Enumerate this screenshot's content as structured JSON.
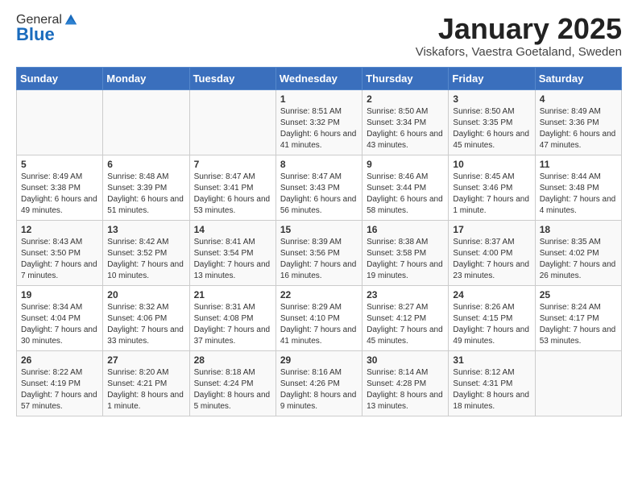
{
  "header": {
    "logo_general": "General",
    "logo_blue": "Blue",
    "month_year": "January 2025",
    "location": "Viskafors, Vaestra Goetaland, Sweden"
  },
  "weekdays": [
    "Sunday",
    "Monday",
    "Tuesday",
    "Wednesday",
    "Thursday",
    "Friday",
    "Saturday"
  ],
  "weeks": [
    [
      {
        "day": "",
        "info": ""
      },
      {
        "day": "",
        "info": ""
      },
      {
        "day": "",
        "info": ""
      },
      {
        "day": "1",
        "info": "Sunrise: 8:51 AM\nSunset: 3:32 PM\nDaylight: 6 hours and 41 minutes."
      },
      {
        "day": "2",
        "info": "Sunrise: 8:50 AM\nSunset: 3:34 PM\nDaylight: 6 hours and 43 minutes."
      },
      {
        "day": "3",
        "info": "Sunrise: 8:50 AM\nSunset: 3:35 PM\nDaylight: 6 hours and 45 minutes."
      },
      {
        "day": "4",
        "info": "Sunrise: 8:49 AM\nSunset: 3:36 PM\nDaylight: 6 hours and 47 minutes."
      }
    ],
    [
      {
        "day": "5",
        "info": "Sunrise: 8:49 AM\nSunset: 3:38 PM\nDaylight: 6 hours and 49 minutes."
      },
      {
        "day": "6",
        "info": "Sunrise: 8:48 AM\nSunset: 3:39 PM\nDaylight: 6 hours and 51 minutes."
      },
      {
        "day": "7",
        "info": "Sunrise: 8:47 AM\nSunset: 3:41 PM\nDaylight: 6 hours and 53 minutes."
      },
      {
        "day": "8",
        "info": "Sunrise: 8:47 AM\nSunset: 3:43 PM\nDaylight: 6 hours and 56 minutes."
      },
      {
        "day": "9",
        "info": "Sunrise: 8:46 AM\nSunset: 3:44 PM\nDaylight: 6 hours and 58 minutes."
      },
      {
        "day": "10",
        "info": "Sunrise: 8:45 AM\nSunset: 3:46 PM\nDaylight: 7 hours and 1 minute."
      },
      {
        "day": "11",
        "info": "Sunrise: 8:44 AM\nSunset: 3:48 PM\nDaylight: 7 hours and 4 minutes."
      }
    ],
    [
      {
        "day": "12",
        "info": "Sunrise: 8:43 AM\nSunset: 3:50 PM\nDaylight: 7 hours and 7 minutes."
      },
      {
        "day": "13",
        "info": "Sunrise: 8:42 AM\nSunset: 3:52 PM\nDaylight: 7 hours and 10 minutes."
      },
      {
        "day": "14",
        "info": "Sunrise: 8:41 AM\nSunset: 3:54 PM\nDaylight: 7 hours and 13 minutes."
      },
      {
        "day": "15",
        "info": "Sunrise: 8:39 AM\nSunset: 3:56 PM\nDaylight: 7 hours and 16 minutes."
      },
      {
        "day": "16",
        "info": "Sunrise: 8:38 AM\nSunset: 3:58 PM\nDaylight: 7 hours and 19 minutes."
      },
      {
        "day": "17",
        "info": "Sunrise: 8:37 AM\nSunset: 4:00 PM\nDaylight: 7 hours and 23 minutes."
      },
      {
        "day": "18",
        "info": "Sunrise: 8:35 AM\nSunset: 4:02 PM\nDaylight: 7 hours and 26 minutes."
      }
    ],
    [
      {
        "day": "19",
        "info": "Sunrise: 8:34 AM\nSunset: 4:04 PM\nDaylight: 7 hours and 30 minutes."
      },
      {
        "day": "20",
        "info": "Sunrise: 8:32 AM\nSunset: 4:06 PM\nDaylight: 7 hours and 33 minutes."
      },
      {
        "day": "21",
        "info": "Sunrise: 8:31 AM\nSunset: 4:08 PM\nDaylight: 7 hours and 37 minutes."
      },
      {
        "day": "22",
        "info": "Sunrise: 8:29 AM\nSunset: 4:10 PM\nDaylight: 7 hours and 41 minutes."
      },
      {
        "day": "23",
        "info": "Sunrise: 8:27 AM\nSunset: 4:12 PM\nDaylight: 7 hours and 45 minutes."
      },
      {
        "day": "24",
        "info": "Sunrise: 8:26 AM\nSunset: 4:15 PM\nDaylight: 7 hours and 49 minutes."
      },
      {
        "day": "25",
        "info": "Sunrise: 8:24 AM\nSunset: 4:17 PM\nDaylight: 7 hours and 53 minutes."
      }
    ],
    [
      {
        "day": "26",
        "info": "Sunrise: 8:22 AM\nSunset: 4:19 PM\nDaylight: 7 hours and 57 minutes."
      },
      {
        "day": "27",
        "info": "Sunrise: 8:20 AM\nSunset: 4:21 PM\nDaylight: 8 hours and 1 minute."
      },
      {
        "day": "28",
        "info": "Sunrise: 8:18 AM\nSunset: 4:24 PM\nDaylight: 8 hours and 5 minutes."
      },
      {
        "day": "29",
        "info": "Sunrise: 8:16 AM\nSunset: 4:26 PM\nDaylight: 8 hours and 9 minutes."
      },
      {
        "day": "30",
        "info": "Sunrise: 8:14 AM\nSunset: 4:28 PM\nDaylight: 8 hours and 13 minutes."
      },
      {
        "day": "31",
        "info": "Sunrise: 8:12 AM\nSunset: 4:31 PM\nDaylight: 8 hours and 18 minutes."
      },
      {
        "day": "",
        "info": ""
      }
    ]
  ]
}
